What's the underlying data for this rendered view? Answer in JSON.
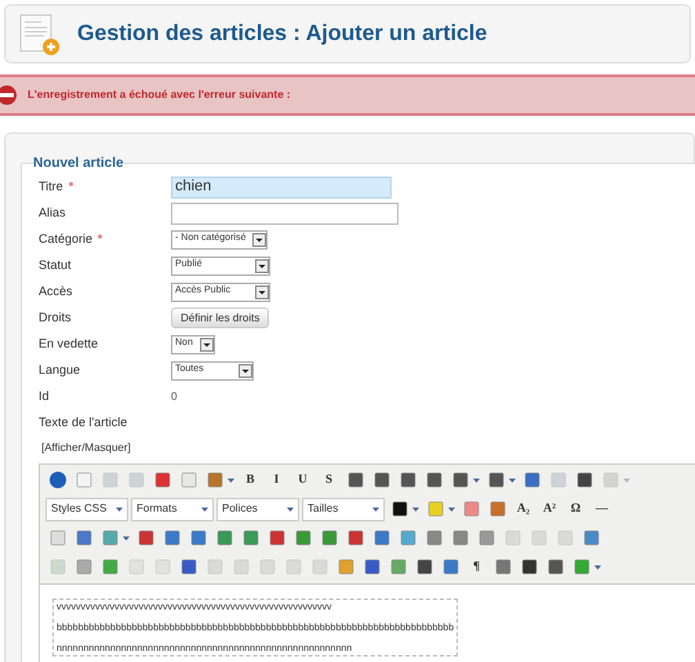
{
  "header": {
    "title": "Gestion des articles : Ajouter un article"
  },
  "error": {
    "message": "L'enregistrement a échoué avec l'erreur suivante :"
  },
  "form": {
    "legend": "Nouvel article",
    "fields": [
      {
        "kind": "text",
        "label": "Titre",
        "required": true,
        "value": "chien",
        "highlighted": true
      },
      {
        "kind": "text",
        "label": "Alias",
        "required": false,
        "highlighted": false
      },
      {
        "kind": "select",
        "label": "Catégorie",
        "required": true,
        "value": "- Non catégorisé"
      },
      {
        "kind": "select",
        "label": "Statut",
        "required": false,
        "value": "Publié"
      },
      {
        "kind": "select",
        "label": "Accès",
        "required": false,
        "value": "Accès Public"
      },
      {
        "kind": "button",
        "label": "Droits",
        "required": false,
        "value": "Définir les droits"
      },
      {
        "kind": "select",
        "label": "En vedette",
        "required": false,
        "value": "Non"
      },
      {
        "kind": "select",
        "label": "Langue",
        "required": false,
        "value": "Toutes"
      },
      {
        "kind": "static",
        "label": "Id",
        "required": false,
        "value": "0"
      }
    ],
    "text_label": "Texte de l'article",
    "toggle": "[Afficher/Masquer]"
  },
  "toolbar": {
    "rows": [
      {
        "items": [
          {
            "kind": "icon",
            "disabled": false
          },
          {
            "kind": "icon",
            "disabled": false
          },
          {
            "kind": "icon",
            "disabled": true
          },
          {
            "kind": "icon",
            "disabled": true
          },
          {
            "kind": "icon",
            "disabled": false
          },
          {
            "kind": "icon",
            "disabled": false
          },
          {
            "kind": "menu",
            "disabled": false
          },
          {
            "kind": "glyph",
            "label": "B",
            "disabled": false
          },
          {
            "kind": "glyph",
            "label": "I",
            "disabled": false
          },
          {
            "kind": "glyph",
            "label": "U",
            "disabled": false
          },
          {
            "kind": "glyph",
            "label": "S",
            "disabled": false
          },
          {
            "kind": "icon",
            "disabled": false
          },
          {
            "kind": "icon",
            "disabled": false
          },
          {
            "kind": "icon",
            "disabled": false
          },
          {
            "kind": "icon",
            "disabled": false
          },
          {
            "kind": "menu",
            "disabled": false
          },
          {
            "kind": "menu",
            "disabled": false
          },
          {
            "kind": "icon",
            "disabled": false
          },
          {
            "kind": "icon",
            "disabled": true
          },
          {
            "kind": "icon",
            "disabled": false
          },
          {
            "kind": "menu",
            "disabled": true
          }
        ]
      },
      {
        "items": [
          {
            "kind": "select",
            "label": "Styles CSS",
            "disabled": false
          },
          {
            "kind": "select",
            "label": "Formats",
            "disabled": false
          },
          {
            "kind": "select",
            "label": "Polices",
            "disabled": false
          },
          {
            "kind": "select",
            "label": "Tailles",
            "disabled": false
          },
          {
            "kind": "menu",
            "disabled": false
          },
          {
            "kind": "menu",
            "disabled": false
          },
          {
            "kind": "icon",
            "disabled": false
          },
          {
            "kind": "icon",
            "disabled": false
          },
          {
            "kind": "glyph",
            "label": "A₂",
            "disabled": false
          },
          {
            "kind": "glyph",
            "label": "A²",
            "disabled": false
          },
          {
            "kind": "glyph",
            "label": "Ω",
            "disabled": false
          },
          {
            "kind": "glyph",
            "label": "—",
            "disabled": false
          }
        ]
      },
      {
        "items": [
          {
            "kind": "icon",
            "disabled": false
          },
          {
            "kind": "icon",
            "disabled": false
          },
          {
            "kind": "menu",
            "disabled": false
          },
          {
            "kind": "icon",
            "disabled": false
          },
          {
            "kind": "icon",
            "disabled": false
          },
          {
            "kind": "icon",
            "disabled": false
          },
          {
            "kind": "icon",
            "disabled": false
          },
          {
            "kind": "icon",
            "disabled": false
          },
          {
            "kind": "icon",
            "disabled": false
          },
          {
            "kind": "icon",
            "disabled": false
          },
          {
            "kind": "icon",
            "disabled": false
          },
          {
            "kind": "icon",
            "disabled": false
          },
          {
            "kind": "icon",
            "disabled": false
          },
          {
            "kind": "icon",
            "disabled": false
          },
          {
            "kind": "icon",
            "disabled": false
          },
          {
            "kind": "icon",
            "disabled": false
          },
          {
            "kind": "icon",
            "disabled": false
          },
          {
            "kind": "icon",
            "disabled": true
          },
          {
            "kind": "icon",
            "disabled": true
          },
          {
            "kind": "icon",
            "disabled": true
          },
          {
            "kind": "icon",
            "disabled": false
          }
        ]
      },
      {
        "items": [
          {
            "kind": "icon",
            "disabled": true
          },
          {
            "kind": "icon",
            "disabled": false
          },
          {
            "kind": "icon",
            "disabled": false
          },
          {
            "kind": "icon",
            "disabled": true
          },
          {
            "kind": "icon",
            "disabled": true
          },
          {
            "kind": "icon",
            "disabled": false
          },
          {
            "kind": "icon",
            "disabled": true
          },
          {
            "kind": "icon",
            "disabled": true
          },
          {
            "kind": "icon",
            "disabled": true
          },
          {
            "kind": "icon",
            "disabled": true
          },
          {
            "kind": "icon",
            "disabled": true
          },
          {
            "kind": "icon",
            "disabled": false
          },
          {
            "kind": "icon",
            "disabled": false
          },
          {
            "kind": "icon",
            "disabled": false
          },
          {
            "kind": "icon",
            "disabled": false
          },
          {
            "kind": "icon",
            "disabled": false
          },
          {
            "kind": "glyph",
            "label": "¶",
            "disabled": false
          },
          {
            "kind": "icon",
            "disabled": false
          },
          {
            "kind": "icon",
            "disabled": false
          },
          {
            "kind": "icon",
            "disabled": false
          },
          {
            "kind": "menu",
            "disabled": false
          }
        ]
      }
    ]
  },
  "content": {
    "lines": [
      "vvvvvvvvvvvvvvvvvvvvvvvvvvvvvvvvvvvvvvvvvvvvvvvvvvvvvvvvv",
      "bbbbbbbbbbbbbbbbbbbbbbbbbbbbbbbbbbbbbbbbbbbbbbbbbbbbbbbbbbbbbbbbbbbbbbbbbb",
      "nnnnnnnnnnnnnnnnnnnnnnnnnnnnnnnnnnnnnnnnnnnnnnnnnnnnnnn"
    ]
  }
}
